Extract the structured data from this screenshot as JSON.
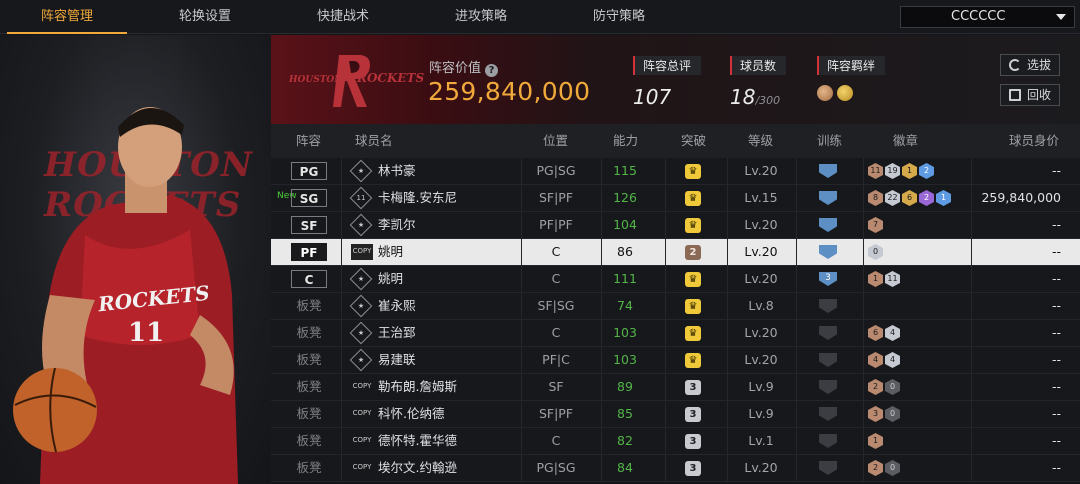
{
  "tabs": [
    {
      "label": "阵容管理",
      "active": true
    },
    {
      "label": "轮换设置",
      "active": false
    },
    {
      "label": "快捷战术",
      "active": false
    },
    {
      "label": "进攻策略",
      "active": false
    },
    {
      "label": "防守策略",
      "active": false
    }
  ],
  "team_select": {
    "value": "CCCCCC"
  },
  "player_card": {
    "bg_text": "HOUSTON ROCKETS",
    "jersey_team": "ROCKETS",
    "jersey_number": "11"
  },
  "header": {
    "logo_text_left": "HOUSTON",
    "logo_text_right": "ROCKETS",
    "lineup_value_label": "阵容价值",
    "lineup_value": "259,840,000",
    "rating_label": "阵容总评",
    "rating": "107",
    "count_label": "球员数",
    "count": "18",
    "count_max": "/300",
    "bond_label": "阵容羁绊",
    "select_button": "选拔",
    "recycle_button": "回收"
  },
  "columns": [
    "阵容",
    "球员名",
    "位置",
    "能力",
    "突破",
    "等级",
    "训练",
    "徽章",
    "球员身价"
  ],
  "accent_color": "#f0a93a",
  "players": [
    {
      "slot": "PG",
      "starter": true,
      "icon": "star",
      "name": "林书豪",
      "position": "PG|SG",
      "ability": "115",
      "breakthrough": "",
      "breakthrough_style": "gold",
      "level": "Lv.20",
      "training": "",
      "training_style": "blue",
      "badges": [
        {
          "v": "11",
          "c": "bronze"
        },
        {
          "v": "19",
          "c": "silver"
        },
        {
          "v": "1",
          "c": "gold"
        },
        {
          "v": "2",
          "c": "blue"
        }
      ],
      "worth": "--",
      "new": ""
    },
    {
      "slot": "SG",
      "starter": true,
      "icon": "11",
      "name": "卡梅隆.安东尼",
      "position": "SF|PF",
      "ability": "126",
      "breakthrough": "",
      "breakthrough_style": "gold",
      "level": "Lv.15",
      "training": "",
      "training_style": "blue",
      "badges": [
        {
          "v": "8",
          "c": "bronze"
        },
        {
          "v": "22",
          "c": "silver"
        },
        {
          "v": "6",
          "c": "gold"
        },
        {
          "v": "2",
          "c": "purple"
        },
        {
          "v": "1",
          "c": "blue"
        }
      ],
      "worth": "259,840,000",
      "new": "New"
    },
    {
      "slot": "SF",
      "starter": true,
      "icon": "star",
      "name": "李凯尔",
      "position": "PF|PF",
      "ability": "104",
      "breakthrough": "",
      "breakthrough_style": "gold",
      "level": "Lv.20",
      "training": "",
      "training_style": "blue",
      "badges": [
        {
          "v": "7",
          "c": "bronze"
        }
      ],
      "worth": "--",
      "new": ""
    },
    {
      "slot": "PF",
      "starter": true,
      "icon": "COPY",
      "name": "姚明",
      "position": "C",
      "ability": "86",
      "breakthrough": "2",
      "breakthrough_style": "brown",
      "level": "Lv.20",
      "training": "",
      "training_style": "blue",
      "badges": [
        {
          "v": "0",
          "c": "silver"
        }
      ],
      "worth": "--",
      "new": "",
      "selected": true
    },
    {
      "slot": "C",
      "starter": true,
      "icon": "star",
      "name": "姚明",
      "position": "C",
      "ability": "111",
      "breakthrough": "",
      "breakthrough_style": "gold",
      "level": "Lv.20",
      "training": "3",
      "training_style": "blue",
      "badges": [
        {
          "v": "1",
          "c": "bronze"
        },
        {
          "v": "11",
          "c": "silver"
        }
      ],
      "worth": "--",
      "new": ""
    },
    {
      "slot": "板凳",
      "starter": false,
      "icon": "star",
      "name": "崔永熙",
      "position": "SF|SG",
      "ability": "74",
      "breakthrough": "",
      "breakthrough_style": "gold",
      "level": "Lv.8",
      "training": "",
      "training_style": "dim",
      "badges": [],
      "worth": "--",
      "new": ""
    },
    {
      "slot": "板凳",
      "starter": false,
      "icon": "star",
      "name": "王治郅",
      "position": "C",
      "ability": "103",
      "breakthrough": "",
      "breakthrough_style": "gold",
      "level": "Lv.20",
      "training": "",
      "training_style": "dim",
      "badges": [
        {
          "v": "6",
          "c": "bronze"
        },
        {
          "v": "4",
          "c": "silver"
        }
      ],
      "worth": "--",
      "new": ""
    },
    {
      "slot": "板凳",
      "starter": false,
      "icon": "star",
      "name": "易建联",
      "position": "PF|C",
      "ability": "103",
      "breakthrough": "",
      "breakthrough_style": "gold",
      "level": "Lv.20",
      "training": "",
      "training_style": "dim",
      "badges": [
        {
          "v": "4",
          "c": "bronze"
        },
        {
          "v": "4",
          "c": "silver"
        }
      ],
      "worth": "--",
      "new": ""
    },
    {
      "slot": "板凳",
      "starter": false,
      "icon": "COPY",
      "name": "勒布朗.詹姆斯",
      "position": "SF",
      "ability": "89",
      "breakthrough": "3",
      "breakthrough_style": "gray",
      "level": "Lv.9",
      "training": "",
      "training_style": "dim",
      "badges": [
        {
          "v": "2",
          "c": "bronze"
        },
        {
          "v": "0",
          "c": "dark"
        }
      ],
      "worth": "--",
      "new": ""
    },
    {
      "slot": "板凳",
      "starter": false,
      "icon": "COPY",
      "name": "科怀.伦纳德",
      "position": "SF|PF",
      "ability": "85",
      "breakthrough": "3",
      "breakthrough_style": "gray",
      "level": "Lv.9",
      "training": "",
      "training_style": "dim",
      "badges": [
        {
          "v": "3",
          "c": "bronze"
        },
        {
          "v": "0",
          "c": "dark"
        }
      ],
      "worth": "--",
      "new": ""
    },
    {
      "slot": "板凳",
      "starter": false,
      "icon": "COPY",
      "name": "德怀特.霍华德",
      "position": "C",
      "ability": "82",
      "breakthrough": "3",
      "breakthrough_style": "gray",
      "level": "Lv.1",
      "training": "",
      "training_style": "dim",
      "badges": [
        {
          "v": "1",
          "c": "bronze"
        }
      ],
      "worth": "--",
      "new": ""
    },
    {
      "slot": "板凳",
      "starter": false,
      "icon": "COPY",
      "name": "埃尔文.约翰逊",
      "position": "PG|SG",
      "ability": "84",
      "breakthrough": "3",
      "breakthrough_style": "gray",
      "level": "Lv.20",
      "training": "",
      "training_style": "dim",
      "badges": [
        {
          "v": "2",
          "c": "bronze"
        },
        {
          "v": "0",
          "c": "dark"
        }
      ],
      "worth": "--",
      "new": ""
    }
  ]
}
